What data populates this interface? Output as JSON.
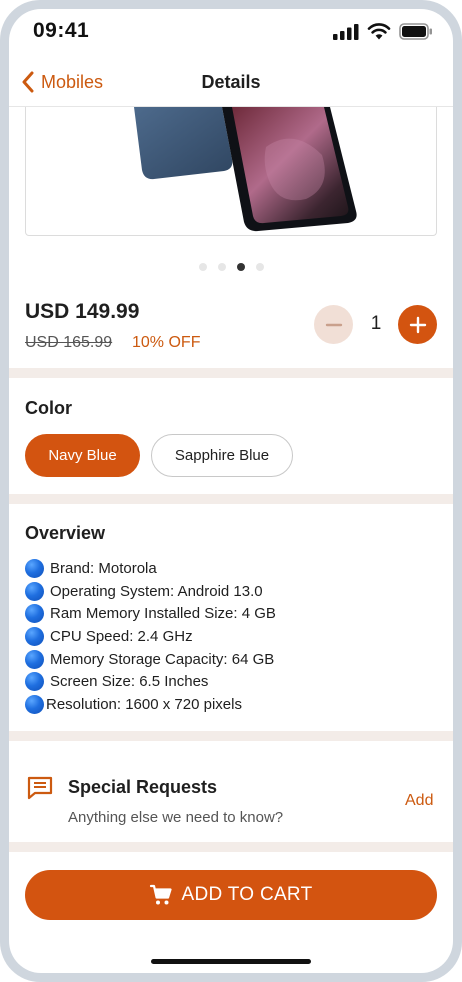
{
  "status_bar": {
    "time": "09:41"
  },
  "nav": {
    "back_label": "Mobiles",
    "title": "Details"
  },
  "gallery": {
    "slide_count": 4,
    "active_index": 2
  },
  "price": {
    "current": "USD 149.99",
    "original": "USD 165.99",
    "discount": "10% OFF"
  },
  "quantity": {
    "value": "1"
  },
  "color": {
    "title": "Color",
    "options": [
      {
        "label": "Navy Blue",
        "selected": true
      },
      {
        "label": "Sapphire Blue",
        "selected": false
      }
    ]
  },
  "overview": {
    "title": "Overview",
    "items": [
      "Brand: Motorola",
      "Operating System: Android 13.0",
      "Ram Memory Installed Size: 4 GB",
      "CPU Speed: 2.4 GHz",
      "Memory Storage Capacity: 64 GB",
      "Screen Size: 6.5 Inches",
      "Resolution: 1600 x 720 pixels"
    ]
  },
  "special_requests": {
    "title": "Special Requests",
    "subtitle": "Anything else we need to know?",
    "action": "Add"
  },
  "cart": {
    "label": "ADD TO CART"
  },
  "colors": {
    "accent": "#d35410",
    "accent_text": "#cc5a10",
    "minus_bg": "#f1dfd6",
    "separator": "#f3ece8"
  }
}
